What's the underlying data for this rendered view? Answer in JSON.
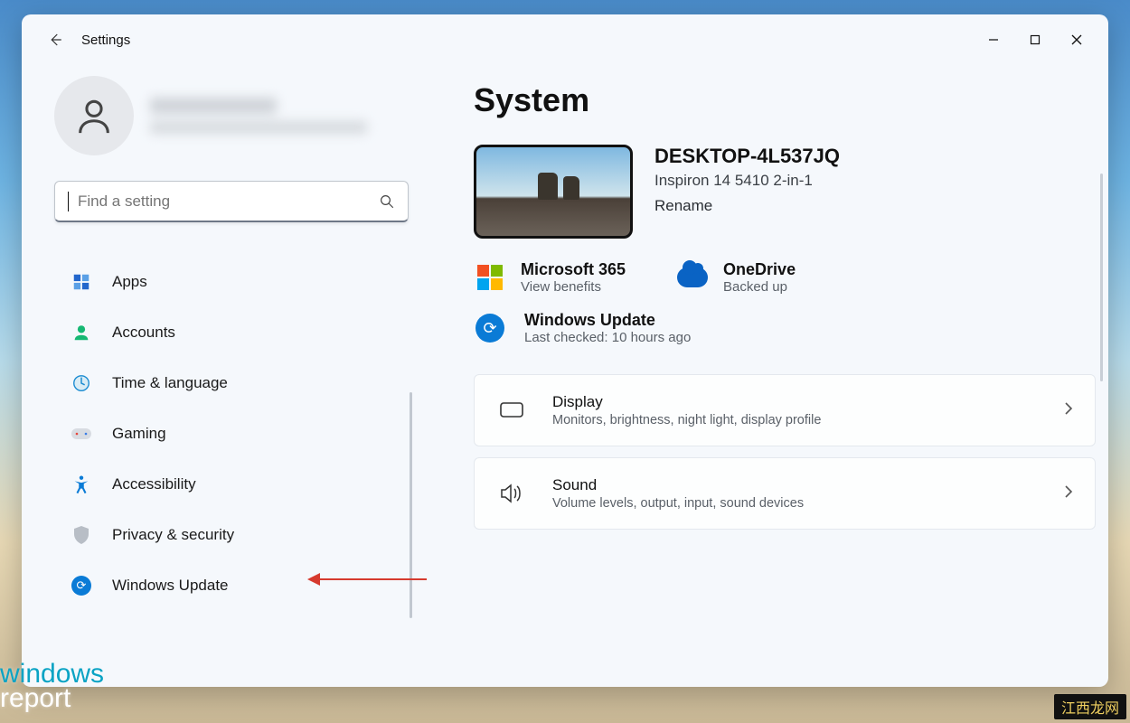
{
  "window": {
    "title": "Settings"
  },
  "search": {
    "placeholder": "Find a setting"
  },
  "sidebar": {
    "items": [
      {
        "label": "Apps",
        "icon": "apps"
      },
      {
        "label": "Accounts",
        "icon": "accounts"
      },
      {
        "label": "Time & language",
        "icon": "time"
      },
      {
        "label": "Gaming",
        "icon": "gaming"
      },
      {
        "label": "Accessibility",
        "icon": "accessibility"
      },
      {
        "label": "Privacy & security",
        "icon": "privacy"
      },
      {
        "label": "Windows Update",
        "icon": "update"
      }
    ]
  },
  "main": {
    "heading": "System",
    "device": {
      "name": "DESKTOP-4L537JQ",
      "model": "Inspiron 14 5410 2-in-1",
      "rename": "Rename"
    },
    "tiles": {
      "m365": {
        "title": "Microsoft 365",
        "sub": "View benefits"
      },
      "onedrive": {
        "title": "OneDrive",
        "sub": "Backed up"
      }
    },
    "update": {
      "title": "Windows Update",
      "sub": "Last checked: 10 hours ago"
    },
    "cards": [
      {
        "icon": "display",
        "title": "Display",
        "sub": "Monitors, brightness, night light, display profile"
      },
      {
        "icon": "sound",
        "title": "Sound",
        "sub": "Volume levels, output, input, sound devices"
      }
    ]
  },
  "watermarks": {
    "left_line1": "windows",
    "left_line2": "report",
    "right": "江西龙网"
  }
}
